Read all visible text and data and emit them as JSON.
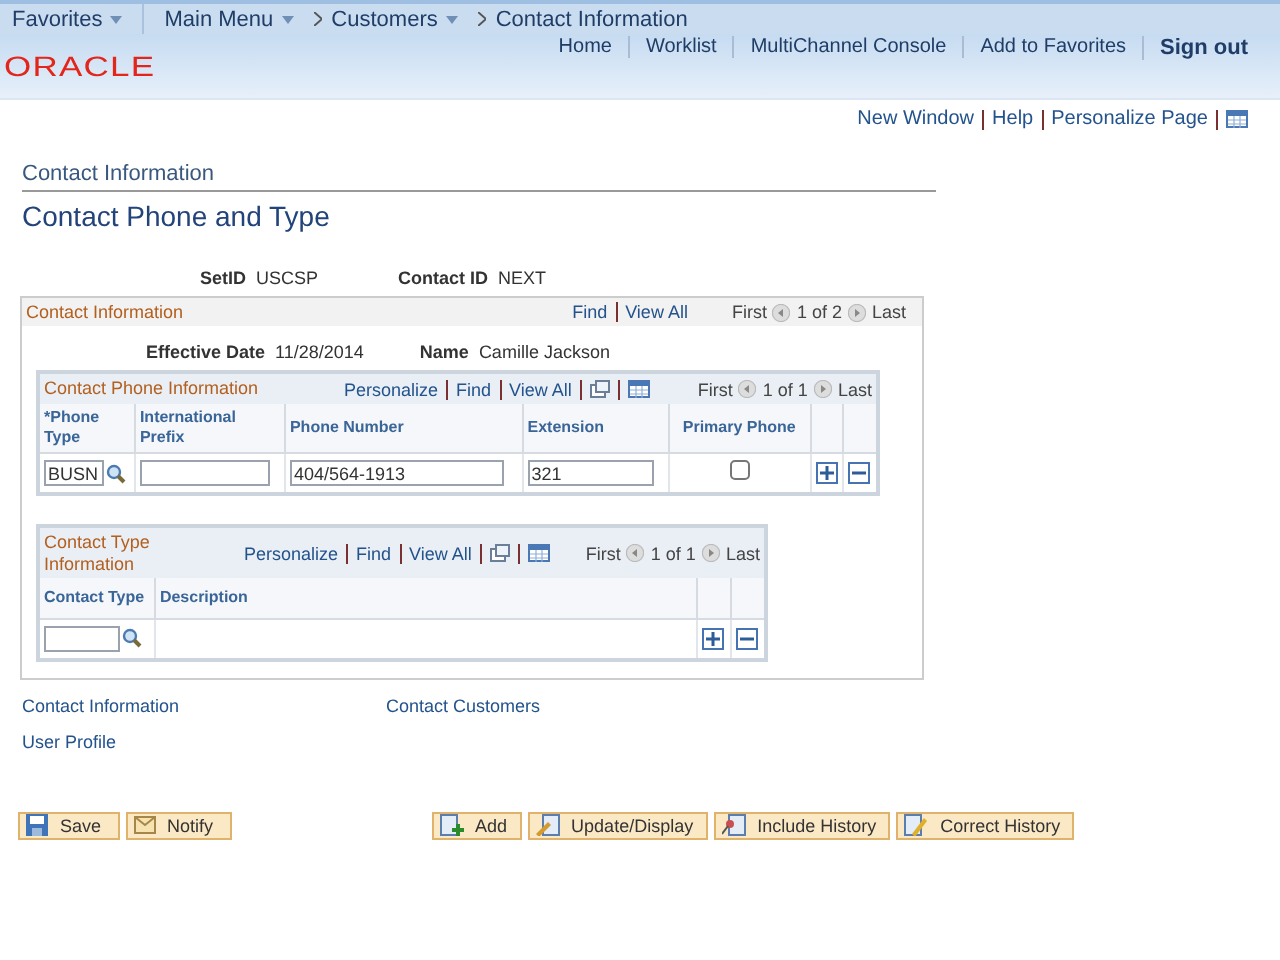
{
  "breadcrumbs": [
    {
      "label": "Favorites",
      "dropdown": true
    },
    {
      "label": "Main Menu",
      "dropdown": true
    },
    {
      "label": "Customers",
      "dropdown": true
    },
    {
      "label": "Contact Information",
      "dropdown": false
    }
  ],
  "header_links": [
    {
      "label": "Home",
      "bold": false
    },
    {
      "label": "Worklist",
      "bold": false
    },
    {
      "label": "MultiChannel Console",
      "bold": false
    },
    {
      "label": "Add to Favorites",
      "bold": false
    },
    {
      "label": "Sign out",
      "bold": true
    }
  ],
  "logo": "ORACLE",
  "page_links": [
    "New Window",
    "Help",
    "Personalize Page"
  ],
  "breadcrumb_title": "Contact Information",
  "page_title": "Contact Phone and Type",
  "key_fields": [
    {
      "label": "SetID",
      "value": "USCSP"
    },
    {
      "label": "Contact ID",
      "value": "NEXT"
    }
  ],
  "section": {
    "title": "Contact Information",
    "links": [
      "Find",
      "View All"
    ],
    "nav": {
      "first": "First",
      "count": "1 of 2",
      "last": "Last"
    },
    "fields": [
      {
        "label": "Effective Date",
        "value": "11/28/2014"
      },
      {
        "label": "Name",
        "value": "Camille Jackson"
      }
    ],
    "grids": [
      {
        "title": "Contact Phone Information",
        "links": [
          "Personalize",
          "Find",
          "View All"
        ],
        "nav": {
          "first": "First",
          "count": "1 of 1",
          "last": "Last"
        },
        "columns": [
          {
            "label": "*Phone Type",
            "center": false
          },
          {
            "label": "International Prefix",
            "center": false
          },
          {
            "label": "Phone Number",
            "center": false
          },
          {
            "label": "Extension",
            "center": false
          },
          {
            "label": "Primary Phone",
            "center": true
          }
        ],
        "rows": [
          [
            {
              "kind": "lookup",
              "value": "BUSN"
            },
            {
              "kind": "input"
            },
            {
              "kind": "input",
              "value": "404/564-1913"
            },
            {
              "kind": "input",
              "value": "321"
            },
            {
              "kind": "checkbox",
              "checked": false
            }
          ]
        ]
      },
      {
        "title": "Contact Type Information",
        "links": [
          "Personalize",
          "Find",
          "View All"
        ],
        "nav": {
          "first": "First",
          "count": "1 of 1",
          "last": "Last"
        },
        "columns": [
          {
            "label": "Contact Type",
            "center": false
          },
          {
            "label": "Description",
            "center": false
          }
        ],
        "rows": [
          [
            {
              "kind": "lookup"
            },
            {
              "kind": "text"
            }
          ]
        ]
      }
    ]
  },
  "bottom_links": [
    "Contact Information",
    "Contact Customers",
    "User Profile"
  ],
  "buttons_left": [
    "Save",
    "Notify"
  ],
  "buttons_right": [
    "Add",
    "Update/Display",
    "Include History",
    "Correct History"
  ]
}
